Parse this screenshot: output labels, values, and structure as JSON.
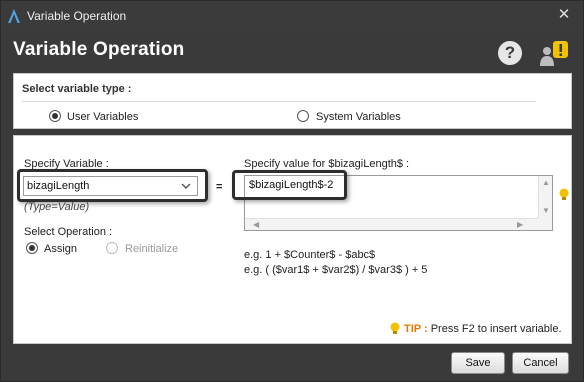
{
  "window": {
    "title": "Variable Operation",
    "close_glyph": "✕",
    "app_icon": "bizagi-logo-icon"
  },
  "header": {
    "title": "Variable Operation",
    "help_glyph": "?",
    "icons": [
      "help-icon",
      "user-alert-icon"
    ]
  },
  "variable_type": {
    "label": "Select variable type :",
    "options": [
      {
        "label": "User Variables",
        "checked": true
      },
      {
        "label": "System Variables",
        "checked": false
      }
    ]
  },
  "specify_variable": {
    "label": "Specify Variable :",
    "selected": "bizagiLength",
    "type_hint": "(Type=Value)"
  },
  "equals": "=",
  "specify_value": {
    "label": "Specify value for $bizagiLength$ :",
    "value": "$bizagiLength$-2"
  },
  "operation": {
    "label": "Select Operation :",
    "options": [
      {
        "label": "Assign",
        "checked": true,
        "disabled": false
      },
      {
        "label": "Reinitialize",
        "checked": false,
        "disabled": true
      }
    ]
  },
  "examples": {
    "line1": "e.g. 1 + $Counter$ - $abc$",
    "line2": "e.g. ( ($var1$ + $var2$) / $var3$ ) + 5"
  },
  "tip": {
    "label": "TIP :",
    "text": "Press F2 to insert variable."
  },
  "footer": {
    "save_label": "Save",
    "cancel_label": "Cancel"
  },
  "colors": {
    "dialog_bg": "#3a3a3a",
    "tip_accent": "#e07a00",
    "bulb_yellow": "#f2c200"
  }
}
